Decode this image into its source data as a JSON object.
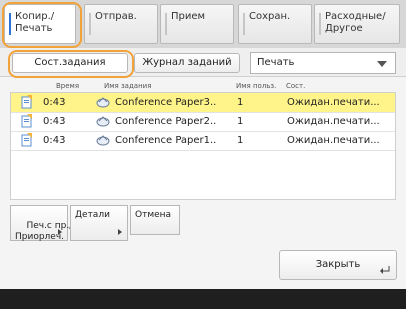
{
  "tabs": [
    {
      "label": "Копир./\nПечать",
      "selected": true
    },
    {
      "label": "Отправ.",
      "selected": false
    },
    {
      "label": "Прием",
      "selected": false
    },
    {
      "label": "Сохран.",
      "selected": false
    },
    {
      "label": "Расходные/\nДругое",
      "selected": false
    }
  ],
  "subtabs": {
    "status": "Сост.задания",
    "log": "Журнал заданий"
  },
  "filter": {
    "selected": "Печать"
  },
  "table": {
    "headers": [
      "Время",
      "Имя задания",
      "Имя польз.",
      "Сост."
    ],
    "rows": [
      {
        "time": "0:43",
        "name": "Conference Paper3..",
        "user": "1",
        "status": "Ожидан.печати...",
        "selected": true
      },
      {
        "time": "0:43",
        "name": "Conference Paper2..",
        "user": "1",
        "status": "Ожидан.печати...",
        "selected": false
      },
      {
        "time": "0:43",
        "name": "Conference Paper1..",
        "user": "1",
        "status": "Ожидан.печати...",
        "selected": false
      }
    ]
  },
  "buttons": {
    "priority": "Печ.с пр./\nПриорлеч.",
    "details": "Детали",
    "cancel": "Отмена",
    "close": "Закрыть"
  },
  "colors": {
    "highlight": "#f1a23a",
    "selected_row": "#fff48a",
    "tab_accent": "#2c72d6"
  }
}
